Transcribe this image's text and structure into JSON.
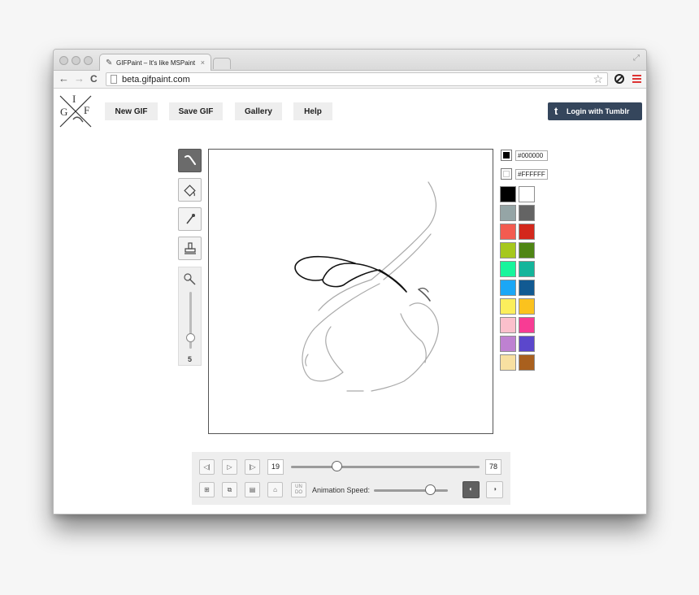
{
  "browser": {
    "tab_title": "GIFPaint – It's like MSPaint",
    "tab_close": "×",
    "url": "beta.gifpaint.com",
    "back": "←",
    "forward": "→",
    "reload": "C",
    "star": "☆"
  },
  "logo": {
    "letters": [
      "I",
      "G",
      "F"
    ]
  },
  "nav": {
    "new_gif": "New GIF",
    "save_gif": "Save GIF",
    "gallery": "Gallery",
    "help": "Help",
    "login": "Login with Tumblr",
    "tumblr_t": "t"
  },
  "tools": {
    "items": [
      "brush",
      "fill",
      "eyedropper",
      "stamp"
    ],
    "active": "brush",
    "brush_size": "5",
    "brush_size_level": 0.2
  },
  "colors": {
    "primary_hex": "#000000",
    "secondary_hex": "#FFFFFF",
    "palette": [
      "#000000",
      "#ffffff",
      "#95a5a6",
      "#646464",
      "#f35b50",
      "#d3281c",
      "#a6c81d",
      "#4f8514",
      "#18f59c",
      "#14b59b",
      "#1ba7f6",
      "#115a92",
      "#fbee5c",
      "#fbc21e",
      "#fbc0cc",
      "#f73c94",
      "#be81d1",
      "#5b47cc",
      "#f8e0a1",
      "#a9601e"
    ]
  },
  "animation": {
    "current_frame": "19",
    "total_frames": "78",
    "frame_position": 0.24,
    "speed_label": "Animation Speed:",
    "speed_level": 0.76,
    "undo_label": "UN DO"
  }
}
